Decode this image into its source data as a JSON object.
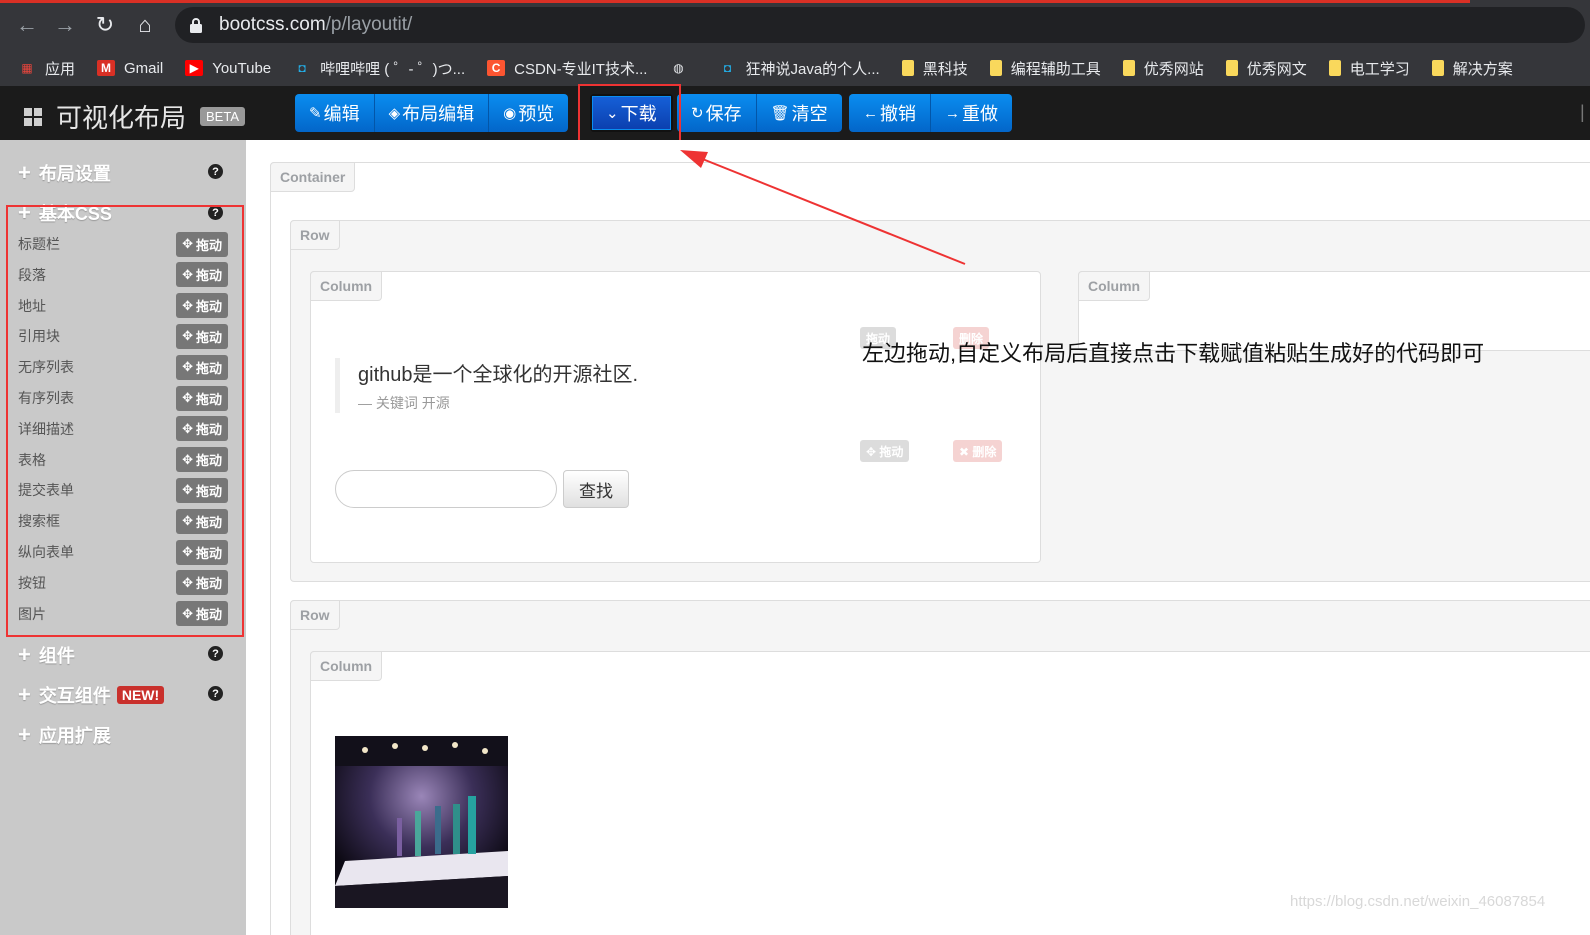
{
  "browser": {
    "url_host": "bootcss.com",
    "url_path": "/p/layoutit/",
    "bookmarks": [
      {
        "label": "应用",
        "icon": "apps-grid-icon"
      },
      {
        "label": "Gmail",
        "icon": "gmail-icon"
      },
      {
        "label": "YouTube",
        "icon": "youtube-icon"
      },
      {
        "label": "哔哩哔哩 ( ゜- ゜)つ...",
        "icon": "bilibili-icon"
      },
      {
        "label": "CSDN-专业IT技术...",
        "icon": "csdn-icon"
      },
      {
        "label": "",
        "icon": "globe-icon"
      },
      {
        "label": "狂神说Java的个人...",
        "icon": "bilibili-icon"
      },
      {
        "label": "黑科技",
        "icon": "folder-icon"
      },
      {
        "label": "编程辅助工具",
        "icon": "folder-icon"
      },
      {
        "label": "优秀网站",
        "icon": "folder-icon"
      },
      {
        "label": "优秀网文",
        "icon": "folder-icon"
      },
      {
        "label": "电工学习",
        "icon": "folder-icon"
      },
      {
        "label": "解决方案",
        "icon": "folder-icon"
      }
    ]
  },
  "appbar": {
    "brand": "可视化布局",
    "beta": "BETA",
    "group1": [
      {
        "icon": "✎",
        "label": "编辑"
      },
      {
        "icon": "◈",
        "label": "布局编辑"
      },
      {
        "icon": "◉",
        "label": "预览"
      }
    ],
    "download": {
      "icon": "⌄",
      "label": "下载"
    },
    "group2": [
      {
        "icon": "↻",
        "label": "保存"
      },
      {
        "icon": "🗑",
        "label": "清空"
      }
    ],
    "group3": [
      {
        "icon": "←",
        "label": "撤销"
      },
      {
        "icon": "→",
        "label": "重做"
      }
    ]
  },
  "sidebar": {
    "sections": [
      {
        "label": "布局设置",
        "help": "?"
      },
      {
        "label": "基本CSS",
        "help": "?"
      },
      {
        "label": "组件",
        "help": "?"
      },
      {
        "label": "交互组件",
        "badge": "NEW!",
        "help": "?"
      },
      {
        "label": "应用扩展"
      }
    ],
    "drag_label": "拖动",
    "items": [
      "标题栏",
      "段落",
      "地址",
      "引用块",
      "无序列表",
      "有序列表",
      "详细描述",
      "表格",
      "提交表单",
      "搜索框",
      "纵向表单",
      "按钮",
      "图片"
    ]
  },
  "canvas": {
    "container_tag": "Container",
    "row_tag": "Row",
    "column_tag": "Column",
    "quote_text": "github是一个全球化的开源社区.",
    "quote_cite": "— 关键词 开源",
    "drag_label": "拖动",
    "delete_label": "删除",
    "search_button": "查找"
  },
  "annotation": "左边拖动,自定义布局后直接点击下载赋值粘贴生成好的代码即可",
  "watermark": "https://blog.csdn.net/weixin_46087854",
  "colors": {
    "toolbar_blue": "#0a8df0",
    "highlight_red": "#e33333",
    "sidebar_bg": "#c9c9c9"
  }
}
